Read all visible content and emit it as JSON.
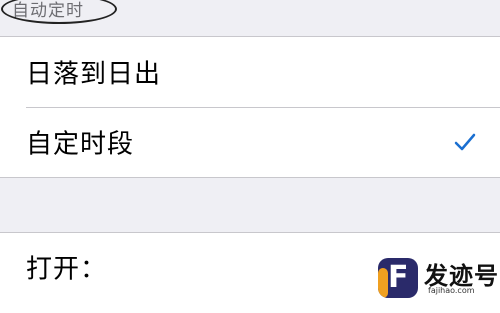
{
  "section": {
    "header_label": "自动定时"
  },
  "schedule_options": [
    {
      "label": "日落到日出",
      "selected": false
    },
    {
      "label": "自定时段",
      "selected": true
    }
  ],
  "time_settings": {
    "open_label": "打开："
  },
  "icons": {
    "checkmark": "check-icon"
  },
  "colors": {
    "accent": "#1a6fd1",
    "grouped_background": "#efeff4",
    "separator": "#c8c7cc",
    "secondary_text": "#6d6d72"
  },
  "watermark": {
    "brand": "发迹号",
    "domain": "fajihao.com"
  }
}
